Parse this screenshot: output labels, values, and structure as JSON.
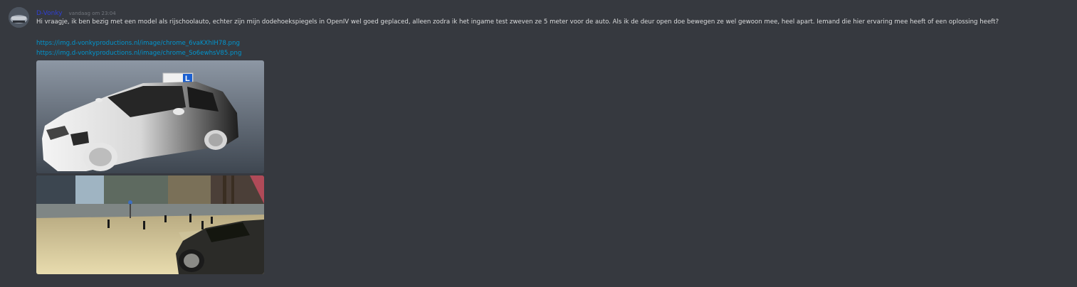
{
  "message": {
    "author": "D-Vonky",
    "timestamp": "vandaag om 23:04",
    "text": "Hi vraagje, ik ben bezig met een model als rijschoolauto, echter zijn mijn dodehoekspiegels in OpenIV wel goed geplaced, alleen zodra ik het ingame test zweven ze 5 meter voor de auto. Als ik de deur open doe bewegen ze wel gewoon mee, heel apart. Iemand die hier ervaring mee heeft of een oplossing heeft?",
    "links": [
      "https://img.d-vonkyproductions.nl/image/chrome_6vaKXhIH78.png",
      "https://img.d-vonkyproductions.nl/image/chrome_So6ewhsV85.png"
    ],
    "attachments": [
      {
        "icon": "car-model-image",
        "roof_sign": "L"
      },
      {
        "icon": "ingame-street-screenshot"
      }
    ]
  },
  "colors": {
    "background": "#36393f",
    "username": "#2f3fd4",
    "timestamp": "#72767d",
    "text": "#dcddde",
    "link": "#0096cf"
  }
}
